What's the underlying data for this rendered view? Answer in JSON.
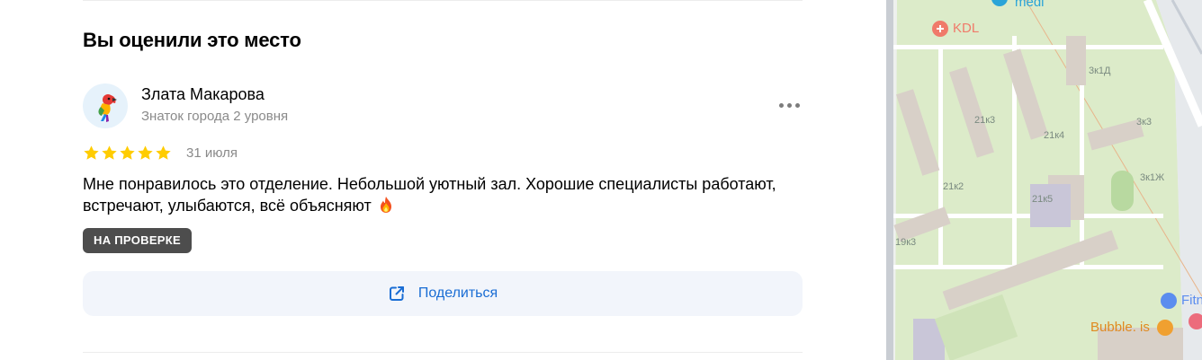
{
  "section": {
    "title": "Вы оценили это место"
  },
  "review": {
    "author_name": "Злата Макарова",
    "author_level": "Знаток города 2 уровня",
    "rating": 5,
    "rating_max": 5,
    "date": "31 июля",
    "text": "Мне понравилось это отделение. Небольшой уютный зал. Хорошие специалисты работают, встречают, улыбаются, всё объясняют",
    "status_badge": "НА ПРОВЕРКЕ"
  },
  "actions": {
    "share_label": "Поделиться"
  },
  "colors": {
    "star": "#ffcc00",
    "accent": "#1a6dd4",
    "badge_bg": "#4d4d4d",
    "share_bg": "#f2f5fb"
  },
  "map": {
    "labels": [
      "medi",
      "KDL",
      "3к1Д",
      "3к3",
      "21к3",
      "21к4",
      "3к1Ж",
      "21к2",
      "21к5",
      "19к3",
      "Fitn",
      "Bubble. is"
    ]
  }
}
